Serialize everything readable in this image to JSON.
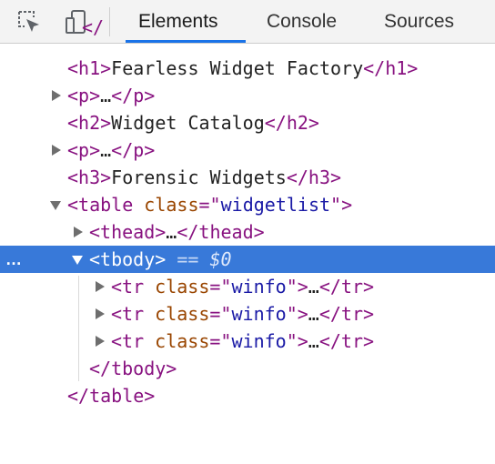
{
  "toolbar": {
    "tabs": [
      {
        "label": "Elements"
      },
      {
        "label": "Console"
      },
      {
        "label": "Sources"
      }
    ]
  },
  "dom_tree": {
    "partial_top": "</",
    "h1": {
      "open": "<h1>",
      "text": "Fearless Widget Factory",
      "close": "</h1>"
    },
    "p1": {
      "open": "<p>",
      "ellipsis": "…",
      "close": "</p>"
    },
    "h2": {
      "open": "<h2>",
      "text": "Widget Catalog",
      "close": "</h2>"
    },
    "p2": {
      "open": "<p>",
      "ellipsis": "…",
      "close": "</p>"
    },
    "h3": {
      "open": "<h3>",
      "text": "Forensic Widgets",
      "close": "</h3>"
    },
    "table": {
      "open_start": "<table",
      "attr_name": "class",
      "eq": "=\"",
      "attr_value": "widgetlist",
      "open_end": "\">",
      "close": "</table>"
    },
    "thead": {
      "open": "<thead>",
      "ellipsis": "…",
      "close": "</thead>"
    },
    "tbody": {
      "open": "<tbody>",
      "equals": "==",
      "ref": "$0",
      "close": "</tbody>",
      "row_gutter": "…"
    },
    "rows": [
      {
        "open_start": "<tr",
        "attr_name": "class",
        "eq": "=\"",
        "attr_value": "winfo",
        "open_end": "\">",
        "ellipsis": "…",
        "close": "</tr>"
      },
      {
        "open_start": "<tr",
        "attr_name": "class",
        "eq": "=\"",
        "attr_value": "winfo",
        "open_end": "\">",
        "ellipsis": "…",
        "close": "</tr>"
      },
      {
        "open_start": "<tr",
        "attr_name": "class",
        "eq": "=\"",
        "attr_value": "winfo",
        "open_end": "\">",
        "ellipsis": "…",
        "close": "</tr>"
      }
    ]
  },
  "colors": {
    "tag": "#881280",
    "attr": "#994500",
    "value": "#1a1aa6",
    "selection": "#3879d9",
    "active_tab": "#1a73e8"
  },
  "icons": {
    "inspect": "inspect-element-icon",
    "device": "device-toolbar-icon",
    "expand": "triangle-right-icon",
    "collapse": "triangle-down-icon"
  }
}
